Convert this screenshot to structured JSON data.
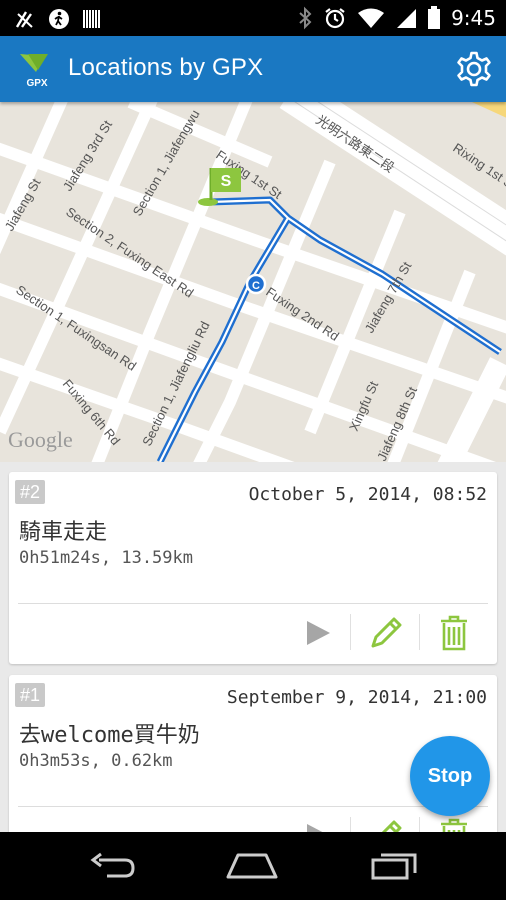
{
  "status_bar": {
    "time": "9:45"
  },
  "app_bar": {
    "title": "Locations by GPX",
    "logo_text": "GPX"
  },
  "map": {
    "attribution": "Google",
    "labels": {
      "jiafeng3": "Jiafeng 3rd St",
      "jiafengwu": "Section 1, Jiafengwu",
      "fuxing1": "Fuxing 1st St",
      "guangming": "光明六路東二段",
      "rixing1": "Rixing 1st St",
      "jiafeng": "Jiafeng St",
      "fuxingeast": "Section 2, Fuxing East Rd",
      "fuxingsan": "Section 1, Fuxingsan Rd",
      "fuxing2": "Fuxing 2nd Rd",
      "jiafeng7": "Jiafeng 7th St",
      "jiafengliu": "Section 1, Jiafengliu Rd",
      "fuxing6": "Fuxing 6th Rd",
      "xingfu": "Xingfu St",
      "jiafeng8": "Jiafeng 8th St"
    },
    "start_marker": "S",
    "current_marker": "C"
  },
  "records": [
    {
      "index": "#2",
      "date": "October 5, 2014, 08:52",
      "name": "騎車走走",
      "summary": "0h51m24s, 13.59km"
    },
    {
      "index": "#1",
      "date": "September 9, 2014, 21:00",
      "name": "去welcome買牛奶",
      "summary": "0h3m53s, 0.62km"
    }
  ],
  "actions": {
    "play": "play-icon",
    "edit": "pencil-icon",
    "delete": "trash-icon"
  },
  "fab": {
    "label": "Stop"
  },
  "colors": {
    "app_bar": "#1a78c2",
    "accent_green": "#8dc63f",
    "fab": "#2196e8",
    "route": "#1f6fd0"
  }
}
